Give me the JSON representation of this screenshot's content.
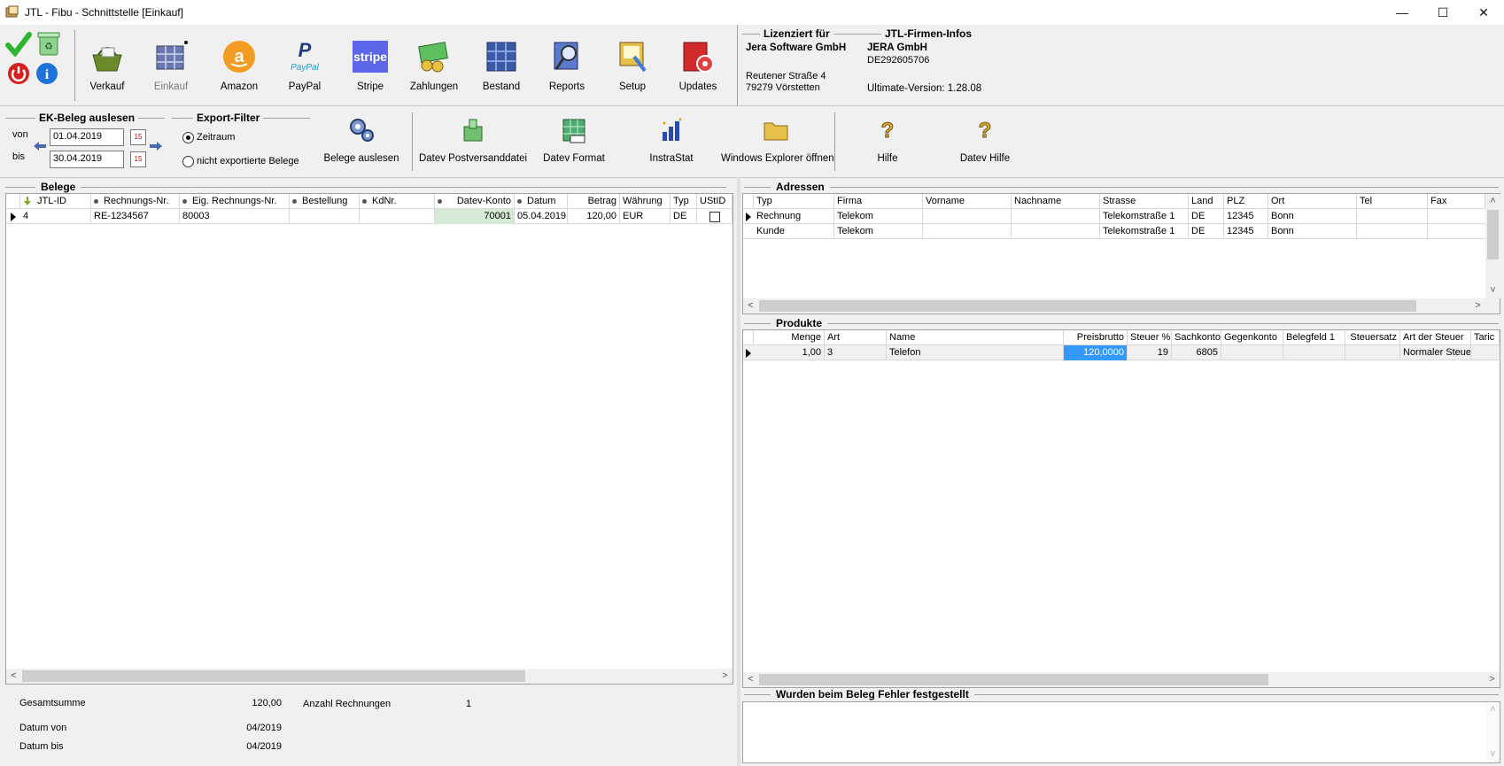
{
  "window": {
    "title": "JTL - Fibu - Schnittstelle [Einkauf]",
    "min": "—",
    "max": "☐",
    "close": "✕"
  },
  "toolbar": {
    "items": [
      {
        "label": "Verkauf"
      },
      {
        "label": "Einkauf"
      },
      {
        "label": "Amazon"
      },
      {
        "label": "PayPal"
      },
      {
        "label": "Stripe"
      },
      {
        "label": "Zahlungen"
      },
      {
        "label": "Bestand"
      },
      {
        "label": "Reports"
      },
      {
        "label": "Setup"
      },
      {
        "label": "Updates"
      }
    ],
    "paypal_logo": "PayPal",
    "stripe_logo": "stripe",
    "amazon_logo": "a"
  },
  "license": {
    "heading": "Lizenziert für",
    "company": "Jera Software GmbH",
    "street": "Reutener Straße 4",
    "city": "79279 Vörstetten"
  },
  "firm": {
    "heading": "JTL-Firmen-Infos",
    "name": "JERA GmbH",
    "id": "DE292605706",
    "version": "Ultimate-Version: 1.28.08"
  },
  "filter": {
    "ek_heading": "EK-Beleg auslesen",
    "von_label": "von",
    "bis_label": "bis",
    "von_value": "01.04.2019",
    "bis_value": "30.04.2019",
    "cal_label": "15",
    "export_heading": "Export-Filter",
    "radio_zeitraum": "Zeitraum",
    "radio_nicht": "nicht exportierte Belege",
    "buttons": [
      {
        "label": "Belege auslesen"
      },
      {
        "label": "Datev Postversanddatei"
      },
      {
        "label": "Datev Format"
      },
      {
        "label": "InstraStat"
      },
      {
        "label": "Windows Explorer öffnen"
      },
      {
        "label": "Hilfe"
      },
      {
        "label": "Datev Hilfe"
      }
    ]
  },
  "belege": {
    "title": "Belege",
    "columns": [
      "JTL-ID",
      "Rechnungs-Nr.",
      "Eig. Rechnungs-Nr.",
      "Bestellung",
      "KdNr.",
      "Datev-Konto",
      "Datum",
      "Betrag",
      "Währung",
      "Typ",
      "UStID"
    ],
    "row": {
      "jtl_id": "4",
      "rechnungs_nr": "RE-1234567",
      "eig_nr": "80003",
      "bestellung": "",
      "kdnr": "",
      "datev_konto": "70001",
      "datum": "05.04.2019",
      "betrag": "120,00",
      "waehrung": "EUR",
      "typ": "DE"
    }
  },
  "summary": {
    "gesamtsumme_label": "Gesamtsumme",
    "gesamtsumme": "120,00",
    "anzahl_label": "Anzahl Rechnungen",
    "anzahl": "1",
    "datum_von_label": "Datum von",
    "datum_von": "04/2019",
    "datum_bis_label": "Datum bis",
    "datum_bis": "04/2019"
  },
  "adressen": {
    "title": "Adressen",
    "columns": [
      "Typ",
      "Firma",
      "Vorname",
      "Nachname",
      "Strasse",
      "Land",
      "PLZ",
      "Ort",
      "Tel",
      "Fax"
    ],
    "rows": [
      {
        "typ": "Rechnung",
        "firma": "Telekom",
        "strasse": "Telekomstraße 1",
        "land": "DE",
        "plz": "12345",
        "ort": "Bonn"
      },
      {
        "typ": "Kunde",
        "firma": "Telekom",
        "strasse": "Telekomstraße 1",
        "land": "DE",
        "plz": "12345",
        "ort": "Bonn"
      }
    ]
  },
  "produkte": {
    "title": "Produkte",
    "columns": [
      "Menge",
      "Art",
      "Name",
      "Preisbrutto",
      "Steuer %",
      "Sachkonto",
      "Gegenkonto",
      "Belegfeld 1",
      "Steuersatz",
      "Art der Steuer",
      "Taric"
    ],
    "row": {
      "menge": "1,00",
      "art": "3",
      "name": "Telefon",
      "preisbrutto": "120,0000",
      "steuer": "19",
      "sachkonto": "6805",
      "gegenkonto": "",
      "belegfeld": "",
      "steuersatz": "",
      "art_steuer": "Normaler Steue"
    }
  },
  "fehler": {
    "title": "Wurden beim Beleg Fehler festgestellt"
  },
  "colors": {
    "accent_selection": "#3399ff",
    "highlight_cell": "#d4ead4"
  }
}
